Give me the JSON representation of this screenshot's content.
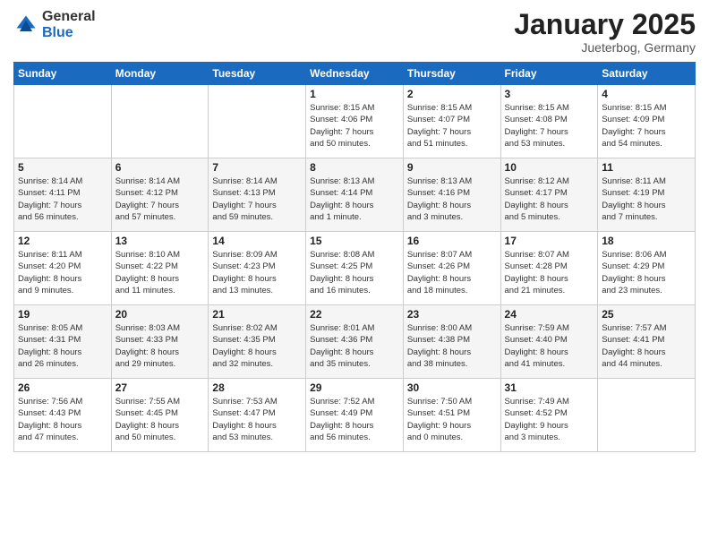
{
  "logo": {
    "general": "General",
    "blue": "Blue"
  },
  "header": {
    "title": "January 2025",
    "subtitle": "Jueterbog, Germany"
  },
  "weekdays": [
    "Sunday",
    "Monday",
    "Tuesday",
    "Wednesday",
    "Thursday",
    "Friday",
    "Saturday"
  ],
  "weeks": [
    [
      {
        "day": "",
        "info": ""
      },
      {
        "day": "",
        "info": ""
      },
      {
        "day": "",
        "info": ""
      },
      {
        "day": "1",
        "info": "Sunrise: 8:15 AM\nSunset: 4:06 PM\nDaylight: 7 hours\nand 50 minutes."
      },
      {
        "day": "2",
        "info": "Sunrise: 8:15 AM\nSunset: 4:07 PM\nDaylight: 7 hours\nand 51 minutes."
      },
      {
        "day": "3",
        "info": "Sunrise: 8:15 AM\nSunset: 4:08 PM\nDaylight: 7 hours\nand 53 minutes."
      },
      {
        "day": "4",
        "info": "Sunrise: 8:15 AM\nSunset: 4:09 PM\nDaylight: 7 hours\nand 54 minutes."
      }
    ],
    [
      {
        "day": "5",
        "info": "Sunrise: 8:14 AM\nSunset: 4:11 PM\nDaylight: 7 hours\nand 56 minutes."
      },
      {
        "day": "6",
        "info": "Sunrise: 8:14 AM\nSunset: 4:12 PM\nDaylight: 7 hours\nand 57 minutes."
      },
      {
        "day": "7",
        "info": "Sunrise: 8:14 AM\nSunset: 4:13 PM\nDaylight: 7 hours\nand 59 minutes."
      },
      {
        "day": "8",
        "info": "Sunrise: 8:13 AM\nSunset: 4:14 PM\nDaylight: 8 hours\nand 1 minute."
      },
      {
        "day": "9",
        "info": "Sunrise: 8:13 AM\nSunset: 4:16 PM\nDaylight: 8 hours\nand 3 minutes."
      },
      {
        "day": "10",
        "info": "Sunrise: 8:12 AM\nSunset: 4:17 PM\nDaylight: 8 hours\nand 5 minutes."
      },
      {
        "day": "11",
        "info": "Sunrise: 8:11 AM\nSunset: 4:19 PM\nDaylight: 8 hours\nand 7 minutes."
      }
    ],
    [
      {
        "day": "12",
        "info": "Sunrise: 8:11 AM\nSunset: 4:20 PM\nDaylight: 8 hours\nand 9 minutes."
      },
      {
        "day": "13",
        "info": "Sunrise: 8:10 AM\nSunset: 4:22 PM\nDaylight: 8 hours\nand 11 minutes."
      },
      {
        "day": "14",
        "info": "Sunrise: 8:09 AM\nSunset: 4:23 PM\nDaylight: 8 hours\nand 13 minutes."
      },
      {
        "day": "15",
        "info": "Sunrise: 8:08 AM\nSunset: 4:25 PM\nDaylight: 8 hours\nand 16 minutes."
      },
      {
        "day": "16",
        "info": "Sunrise: 8:07 AM\nSunset: 4:26 PM\nDaylight: 8 hours\nand 18 minutes."
      },
      {
        "day": "17",
        "info": "Sunrise: 8:07 AM\nSunset: 4:28 PM\nDaylight: 8 hours\nand 21 minutes."
      },
      {
        "day": "18",
        "info": "Sunrise: 8:06 AM\nSunset: 4:29 PM\nDaylight: 8 hours\nand 23 minutes."
      }
    ],
    [
      {
        "day": "19",
        "info": "Sunrise: 8:05 AM\nSunset: 4:31 PM\nDaylight: 8 hours\nand 26 minutes."
      },
      {
        "day": "20",
        "info": "Sunrise: 8:03 AM\nSunset: 4:33 PM\nDaylight: 8 hours\nand 29 minutes."
      },
      {
        "day": "21",
        "info": "Sunrise: 8:02 AM\nSunset: 4:35 PM\nDaylight: 8 hours\nand 32 minutes."
      },
      {
        "day": "22",
        "info": "Sunrise: 8:01 AM\nSunset: 4:36 PM\nDaylight: 8 hours\nand 35 minutes."
      },
      {
        "day": "23",
        "info": "Sunrise: 8:00 AM\nSunset: 4:38 PM\nDaylight: 8 hours\nand 38 minutes."
      },
      {
        "day": "24",
        "info": "Sunrise: 7:59 AM\nSunset: 4:40 PM\nDaylight: 8 hours\nand 41 minutes."
      },
      {
        "day": "25",
        "info": "Sunrise: 7:57 AM\nSunset: 4:41 PM\nDaylight: 8 hours\nand 44 minutes."
      }
    ],
    [
      {
        "day": "26",
        "info": "Sunrise: 7:56 AM\nSunset: 4:43 PM\nDaylight: 8 hours\nand 47 minutes."
      },
      {
        "day": "27",
        "info": "Sunrise: 7:55 AM\nSunset: 4:45 PM\nDaylight: 8 hours\nand 50 minutes."
      },
      {
        "day": "28",
        "info": "Sunrise: 7:53 AM\nSunset: 4:47 PM\nDaylight: 8 hours\nand 53 minutes."
      },
      {
        "day": "29",
        "info": "Sunrise: 7:52 AM\nSunset: 4:49 PM\nDaylight: 8 hours\nand 56 minutes."
      },
      {
        "day": "30",
        "info": "Sunrise: 7:50 AM\nSunset: 4:51 PM\nDaylight: 9 hours\nand 0 minutes."
      },
      {
        "day": "31",
        "info": "Sunrise: 7:49 AM\nSunset: 4:52 PM\nDaylight: 9 hours\nand 3 minutes."
      },
      {
        "day": "",
        "info": ""
      }
    ]
  ]
}
